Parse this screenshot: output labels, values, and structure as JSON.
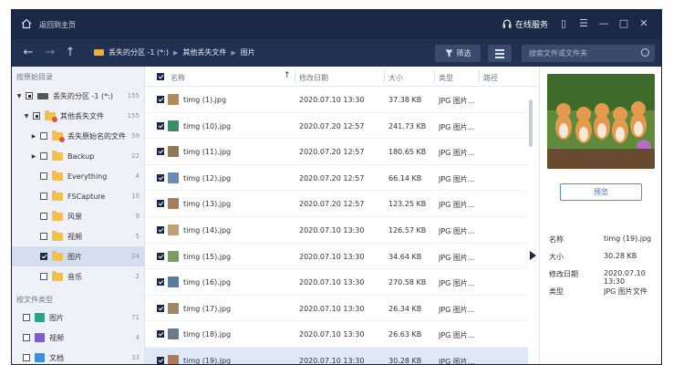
{
  "titlebar": {
    "home_label": "返回到主页",
    "service_label": "在线服务"
  },
  "navbar": {
    "breadcrumbs": [
      "丢失的分区 -1 (*:)",
      "其他丢失文件",
      "图片"
    ],
    "filter_label": "筛选",
    "search_placeholder": "搜索文件或文件夹"
  },
  "sidebar": {
    "section_path": "按原始目录",
    "tree": [
      {
        "label": "丢失的分区 -1 (*:)",
        "count": "155"
      },
      {
        "label": "其他丢失文件",
        "count": "155"
      },
      {
        "label": "丢失原始名的文件",
        "count": "59"
      },
      {
        "label": "Backup",
        "count": "22"
      },
      {
        "label": "Everything",
        "count": "4"
      },
      {
        "label": "FSCapture",
        "count": "10"
      },
      {
        "label": "风景",
        "count": "9"
      },
      {
        "label": "视频",
        "count": "5"
      },
      {
        "label": "图片",
        "count": "24"
      },
      {
        "label": "音乐",
        "count": "2"
      }
    ],
    "section_type": "按文件类型",
    "types": [
      {
        "label": "图片",
        "count": "71",
        "color": "#2aa58a"
      },
      {
        "label": "视频",
        "count": "4",
        "color": "#7b5ad6"
      },
      {
        "label": "文档",
        "count": "33",
        "color": "#3a8ee6"
      }
    ]
  },
  "list": {
    "headers": {
      "name": "名称",
      "date": "修改日期",
      "size": "大小",
      "type": "类型",
      "path": "路径"
    },
    "rows": [
      {
        "name": "timg (1).jpg",
        "date": "2020.07.10 13:30",
        "size": "37.38 KB",
        "type": "JPG 图片..."
      },
      {
        "name": "timg (10).jpg",
        "date": "2020.07.20 12:57",
        "size": "241.73 KB",
        "type": "JPG 图片..."
      },
      {
        "name": "timg (11).jpg",
        "date": "2020.07.20 12:57",
        "size": "180.65 KB",
        "type": "JPG 图片..."
      },
      {
        "name": "timg (12).jpg",
        "date": "2020.07.20 12:57",
        "size": "66.14 KB",
        "type": "JPG 图片..."
      },
      {
        "name": "timg (13).jpg",
        "date": "2020.07.20 12:57",
        "size": "123.25 KB",
        "type": "JPG 图片..."
      },
      {
        "name": "timg (14).jpg",
        "date": "2020.07.10 13:30",
        "size": "126.57 KB",
        "type": "JPG 图片..."
      },
      {
        "name": "timg (15).jpg",
        "date": "2020.07.10 13:30",
        "size": "34.64 KB",
        "type": "JPG 图片..."
      },
      {
        "name": "timg (16).jpg",
        "date": "2020.07.10 13:30",
        "size": "270.58 KB",
        "type": "JPG 图片..."
      },
      {
        "name": "timg (17).jpg",
        "date": "2020.07.10 13:30",
        "size": "26.34 KB",
        "type": "JPG 图片..."
      },
      {
        "name": "timg (18).jpg",
        "date": "2020.07.10 13:30",
        "size": "26.63 KB",
        "type": "JPG 图片..."
      },
      {
        "name": "timg (19).jpg",
        "date": "2020.07.10 13:30",
        "size": "30.28 KB",
        "type": "JPG 图片..."
      }
    ]
  },
  "preview": {
    "button_label": "预览",
    "meta": [
      {
        "key": "名称",
        "value": "timg (19).jpg"
      },
      {
        "key": "大小",
        "value": "30.28 KB"
      },
      {
        "key": "修改日期",
        "value": "2020.07.10 13:30"
      },
      {
        "key": "类型",
        "value": "JPG 图片文件"
      }
    ]
  }
}
